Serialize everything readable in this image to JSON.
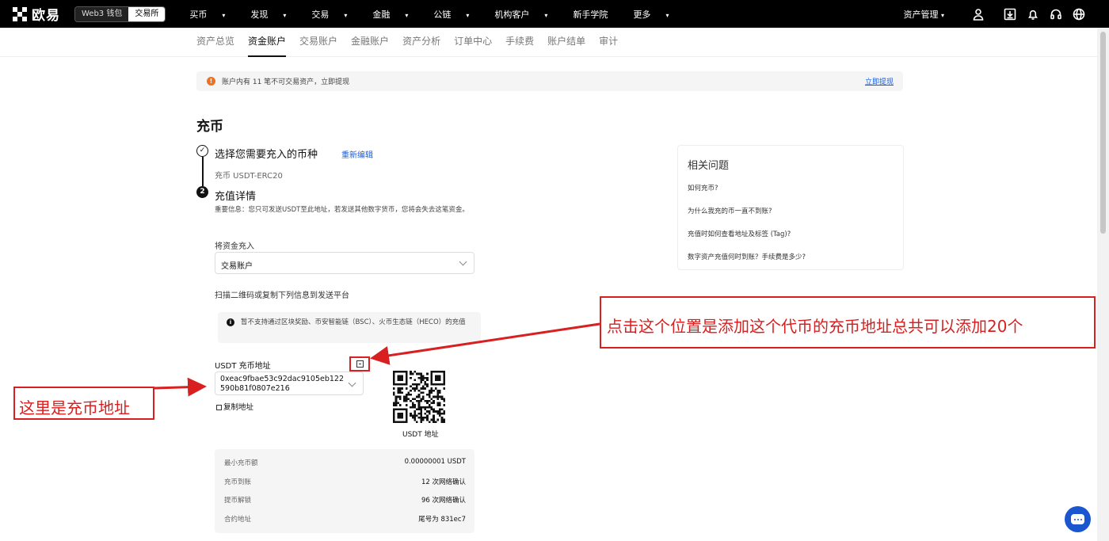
{
  "brand": {
    "name": "欧易"
  },
  "mode_switch": {
    "wallet": "Web3 钱包",
    "exchange": "交易所"
  },
  "top_nav": [
    {
      "label": "买币",
      "has_menu": true
    },
    {
      "label": "发现",
      "has_menu": true
    },
    {
      "label": "交易",
      "has_menu": true
    },
    {
      "label": "金融",
      "has_menu": true
    },
    {
      "label": "公链",
      "has_menu": true
    },
    {
      "label": "机构客户",
      "has_menu": true
    },
    {
      "label": "新手学院",
      "has_menu": false
    },
    {
      "label": "更多",
      "has_menu": true
    }
  ],
  "top_right": {
    "asset_menu": "资产管理"
  },
  "top_icons": [
    "user-icon",
    "download-icon",
    "bell-icon",
    "headset-icon",
    "globe-icon"
  ],
  "sub_nav": [
    {
      "label": "资产总览",
      "active": false
    },
    {
      "label": "资金账户",
      "active": true
    },
    {
      "label": "交易账户",
      "active": false
    },
    {
      "label": "金融账户",
      "active": false
    },
    {
      "label": "资产分析",
      "active": false
    },
    {
      "label": "订单中心",
      "active": false
    },
    {
      "label": "手续费",
      "active": false
    },
    {
      "label": "账户结单",
      "active": false
    },
    {
      "label": "审计",
      "active": false
    }
  ],
  "notice": {
    "text": "账户内有 11 笔不可交易资产，立即提现",
    "link": "立即提现",
    "icon_glyph": "!"
  },
  "page_title": "充币",
  "step1": {
    "number_glyph": "✓",
    "title": "选择您需要充入的币种",
    "edit_link": "重新编辑",
    "summary": "充币 USDT-ERC20"
  },
  "step2": {
    "number": "2",
    "title": "充值详情",
    "important": "重要信息：您只可发送USDT至此地址，若发送其他数字货币，您将会失去这笔资金。"
  },
  "fund_to": {
    "label": "将资金充入",
    "selected": "交易账户"
  },
  "scan_label": "扫描二维码或复制下列信息到发送平台",
  "info_box": {
    "icon_glyph": "i",
    "text": "暂不支持通过区块奖励、币安智能链（BSC）、火币生态链（HECO）的充值"
  },
  "address": {
    "label": "USDT 充币地址",
    "value": "0xeac9fbae53c92dac9105eb122590b81f0807e216",
    "copy_label": "复制地址",
    "qr_label": "USDT 地址"
  },
  "details": [
    {
      "key": "最小充币额",
      "value": "0.00000001 USDT"
    },
    {
      "key": "充币到账",
      "value": "12 次网络确认"
    },
    {
      "key": "提币解锁",
      "value": "96 次网络确认"
    },
    {
      "key": "合约地址",
      "value": "尾号为 831ec7"
    }
  ],
  "faq": {
    "title": "相关问题",
    "questions": [
      "如何充币?",
      "为什么我充的币一直不到账?",
      "充值时如何查看地址及标签 (Tag)?",
      "数字资产充值何时到账？手续费是多少?"
    ]
  },
  "annotations": {
    "add_address_note": "点击这个位置是添加这个代币的充币地址总共可以添加20个",
    "address_note": "这里是充币地址",
    "color": "#d82020"
  },
  "colors": {
    "link": "#1a5ed8",
    "warning": "#f07020",
    "chat": "#1a56d0"
  }
}
